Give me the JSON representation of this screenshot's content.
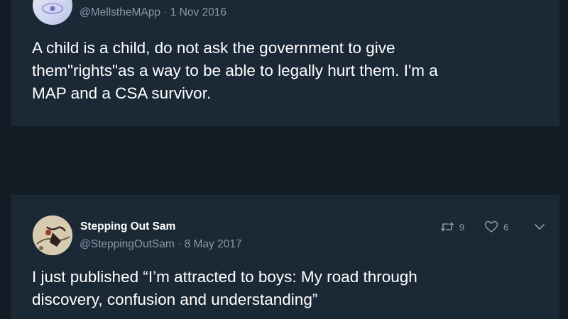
{
  "tweets": [
    {
      "handle": "@MellstheMApp",
      "date": "1 Nov 2016",
      "text": "A child is a child, do not ask the government to give\nthem\"rights\"as a way to be able to legally hurt them. I'm a\nMAP and a CSA survivor."
    },
    {
      "name": "Stepping Out Sam",
      "handle": "@SteppingOutSam",
      "date": "8 May 2017",
      "retweets": "9",
      "likes": "6",
      "text": "I just published “I’m attracted to boys: My road through\ndiscovery, confusion and understanding”"
    }
  ],
  "separator": "·",
  "icons": {
    "retweet": "retweet-icon",
    "like": "heart-icon",
    "more": "chevron-down-icon"
  },
  "colors": {
    "background": "#141d26",
    "card": "#1b2836",
    "primary_text": "#ffffff",
    "secondary_text": "#8899a6"
  }
}
